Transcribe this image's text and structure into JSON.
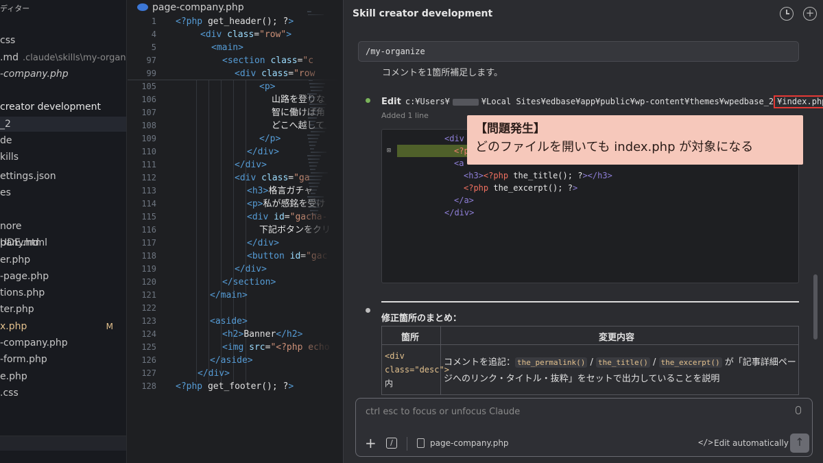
{
  "explorer": {
    "title": "ディター",
    "items": [
      {
        "label": "css",
        "muted": ""
      },
      {
        "label": ".md",
        "muted": ".claude\\skills\\my-organize"
      },
      {
        "label": "-company.php",
        "muted": ""
      },
      {
        "label": "creator development",
        "muted": ""
      },
      {
        "label": "_2",
        "muted": ""
      },
      {
        "label": "de",
        "muted": ""
      },
      {
        "label": "kills",
        "muted": ""
      },
      {
        "label": "ettings.json",
        "muted": ""
      },
      {
        "label": "es",
        "muted": ""
      },
      {
        "label": "nore",
        "muted": ""
      },
      {
        "label": "UDE.md",
        "muted": ""
      },
      {
        "label": "pany.html",
        "muted": ""
      },
      {
        "label": "er.php",
        "muted": ""
      },
      {
        "label": "-page.php",
        "muted": ""
      },
      {
        "label": "tions.php",
        "muted": ""
      },
      {
        "label": "ter.php",
        "muted": ""
      },
      {
        "label": "x.php",
        "muted": "",
        "badge": "M"
      },
      {
        "label": "-company.php",
        "muted": ""
      },
      {
        "label": "-form.php",
        "muted": ""
      },
      {
        "label": "e.php",
        "muted": ""
      },
      {
        "label": ".css",
        "muted": ""
      }
    ]
  },
  "editor": {
    "tab_label": "page-company.php",
    "sticky_lines": [
      {
        "n": "1",
        "code": "<?php get_header(); ?>"
      },
      {
        "n": "4",
        "code": "<div class=\"row\">"
      },
      {
        "n": "5",
        "code": "<main>"
      },
      {
        "n": "97",
        "code": "<section class=\"c"
      },
      {
        "n": "99",
        "code": "<div class=\"row"
      }
    ],
    "lines": [
      {
        "n": "105",
        "code": "<p>"
      },
      {
        "n": "106",
        "code": "山路を登りな"
      },
      {
        "n": "107",
        "code": "智に働けば角"
      },
      {
        "n": "108",
        "code": "どこへ越して"
      },
      {
        "n": "109",
        "code": "</p>"
      },
      {
        "n": "110",
        "code": "</div>"
      },
      {
        "n": "111",
        "code": "</div>"
      },
      {
        "n": "112",
        "code": "<div class=\"ga"
      },
      {
        "n": "113",
        "code": "<h3>格言ガチャ"
      },
      {
        "n": "114",
        "code": "<p>私が感銘を受け"
      },
      {
        "n": "115",
        "code": "<div id=\"gacha-"
      },
      {
        "n": "116",
        "code": "下記ボタンをクリ"
      },
      {
        "n": "117",
        "code": "</div>"
      },
      {
        "n": "118",
        "code": "<button id=\"gac"
      },
      {
        "n": "119",
        "code": "</div>"
      },
      {
        "n": "120",
        "code": "</section>"
      },
      {
        "n": "121",
        "code": "</main>"
      },
      {
        "n": "122",
        "code": ""
      },
      {
        "n": "123",
        "code": "<aside>"
      },
      {
        "n": "124",
        "code": "<h2>Banner</h2>"
      },
      {
        "n": "125",
        "code": "<img src=\"<?php echo"
      },
      {
        "n": "126",
        "code": "</aside>"
      },
      {
        "n": "127",
        "code": "</div>"
      },
      {
        "n": "128",
        "code": "<?php get_footer(); ?>"
      }
    ]
  },
  "claude": {
    "header_title": "Skill creator development",
    "command": "/my-organize",
    "note": "コメントを1箇所補足します。",
    "edit_label": "Edit",
    "edit_path_a": "c:¥Users¥",
    "edit_path_b": "¥Local Sites¥edbase¥app¥public¥wp-content¥themes¥wpedbase_2",
    "edit_file": "¥index.php",
    "added_text": "Added 1 line",
    "diff_lines": [
      "<div",
      "<?p",
      "<a",
      "<h3><?php the_title(); ?></h3>",
      "<?php the_excerpt(); ?>",
      "</a>",
      "</div>"
    ],
    "callout_title": "【問題発生】",
    "callout_text": "どのファイルを開いても index.php が対象になる",
    "summary_title": "修正箇所のまとめ：",
    "table_head_col1": "箇所",
    "table_head_col2": "変更内容",
    "row_col1_code": "<div class=\"desc\">",
    "row_col1_jp": "内",
    "row_col2_pre": "コメントを追記：",
    "row_col2_code1": "the_permalink()",
    "row_col2_sep1": " / ",
    "row_col2_code2": "the_title()",
    "row_col2_sep2": " / ",
    "row_col2_code3": "the_excerpt()",
    "row_col2_post": " が「記事詳細ページへのリンク・タイトル・抜粋」をセットで出力していることを説明",
    "input_placeholder": "ctrl esc to focus or unfocus Claude",
    "file_chip": "page-company.php",
    "edit_mode": "Edit automatically"
  },
  "colors": {
    "callout_bg": "#f6c8bb",
    "highlight_border": "#e53935",
    "diff_added": "#7a9632",
    "modified": "#e2c08d"
  }
}
